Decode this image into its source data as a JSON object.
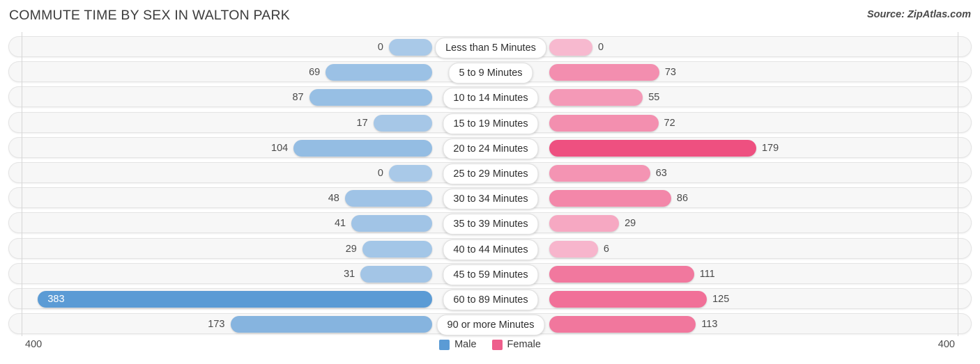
{
  "header": {
    "title": "COMMUTE TIME BY SEX IN WALTON PARK",
    "source": "Source: ZipAtlas.com"
  },
  "axis": {
    "left_tick": "400",
    "right_tick": "400",
    "max": 400
  },
  "legend": {
    "items": [
      {
        "label": "Male",
        "color": "#5b9bd5"
      },
      {
        "label": "Female",
        "color": "#ee5e8c"
      }
    ]
  },
  "colors": {
    "male_min": "#a9c9e8",
    "male_max": "#5b9bd5",
    "female_min": "#f7b9cf",
    "female_max": "#ee5080",
    "track": "#f7f7f7",
    "track_border": "#e4e4e4"
  },
  "chart_data": {
    "type": "bar",
    "title": "COMMUTE TIME BY SEX IN WALTON PARK",
    "orientation": "horizontal-diverging",
    "xlabel": "",
    "ylabel": "",
    "xlim": [
      400,
      400
    ],
    "grid": false,
    "legend_position": "bottom-center",
    "categories": [
      "Less than 5 Minutes",
      "5 to 9 Minutes",
      "10 to 14 Minutes",
      "15 to 19 Minutes",
      "20 to 24 Minutes",
      "25 to 29 Minutes",
      "30 to 34 Minutes",
      "35 to 39 Minutes",
      "40 to 44 Minutes",
      "45 to 59 Minutes",
      "60 to 89 Minutes",
      "90 or more Minutes"
    ],
    "series": [
      {
        "name": "Male",
        "values": [
          0,
          69,
          87,
          17,
          104,
          0,
          48,
          41,
          29,
          31,
          383,
          173
        ]
      },
      {
        "name": "Female",
        "values": [
          0,
          73,
          55,
          72,
          179,
          63,
          86,
          29,
          6,
          111,
          125,
          113
        ]
      }
    ]
  }
}
